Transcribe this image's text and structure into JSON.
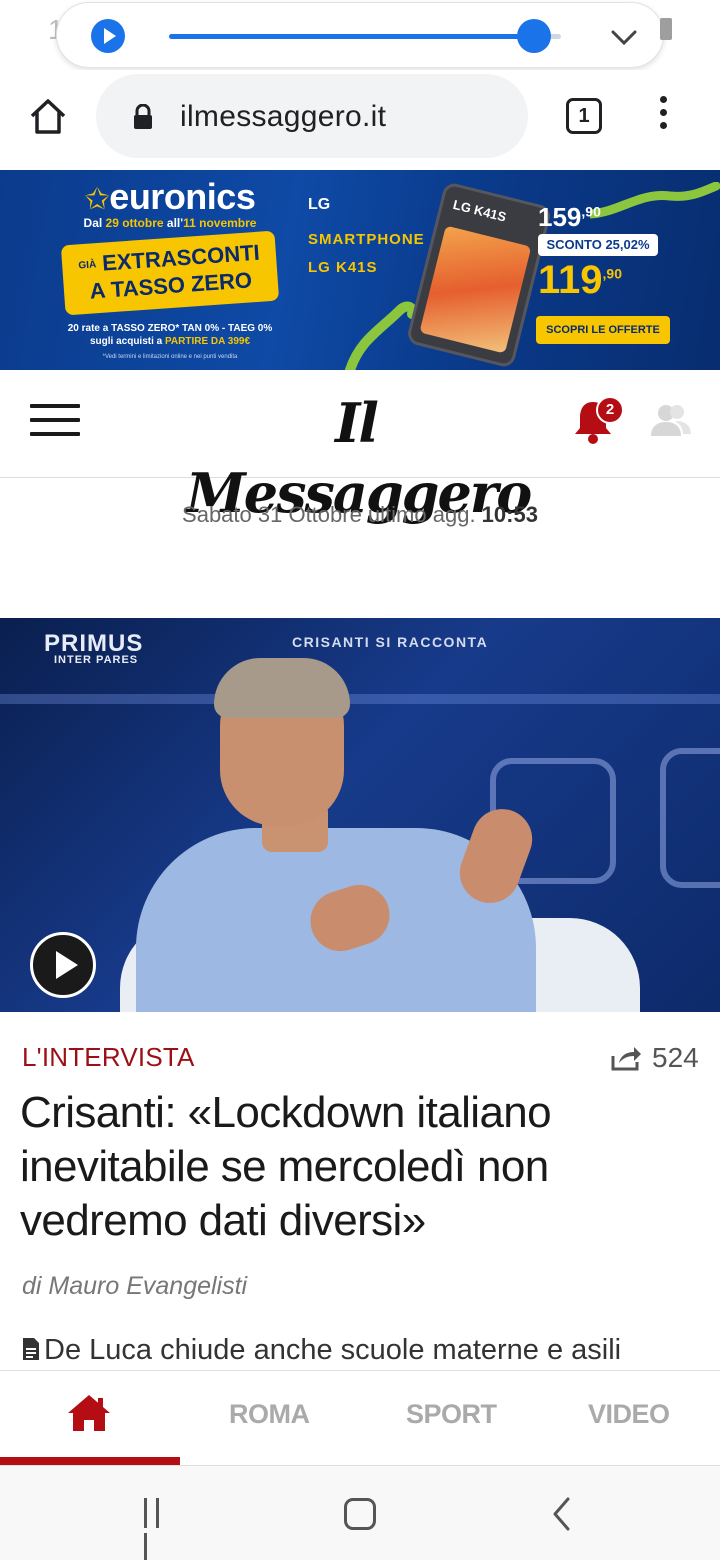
{
  "status": {
    "time": "10:5",
    "media_progress": 0.93
  },
  "browser": {
    "url": "ilmessaggero.it",
    "tab_count": "1",
    "icons": [
      "home-icon",
      "lock-icon",
      "tabs-icon",
      "more-vert-icon"
    ]
  },
  "ad": {
    "logo": "euronics",
    "dates_prefix": "Dal ",
    "date_from": "29 ottobre",
    "dates_mid": " all'",
    "date_to": "11 novembre",
    "promo_small": "GIÀ",
    "promo_line1": "EXTRASCONTI",
    "promo_line2": "A TASSO ZERO",
    "fine_line1": "20 rate a TASSO ZERO* TAN 0% - TAEG 0%",
    "fine_line2_prefix": "sugli acquisti a ",
    "fine_line2_highlight": "PARTIRE DA 399€",
    "fine_print": "*Vedi termini e limitazioni online e nei punti vendita",
    "brand": "LG",
    "model_line1": "SMARTPHONE",
    "model_line2": "LG K41S",
    "phone_label": "LG K41S",
    "old_price_int": "159",
    "old_price_dec": ",90",
    "discount_label": "SCONTO ",
    "discount_value": "25,02%",
    "new_price_int": "119",
    "new_price_dec": ",90",
    "cta": "SCOPRI LE OFFERTE",
    "accent": "#f7c600",
    "background": "#0e4aa6"
  },
  "header": {
    "logo": "Il Messaggero",
    "notification_count": "2",
    "accent": "#b40e14"
  },
  "date_line": {
    "text": "Sabato 31 Ottobre ultimo agg. ",
    "time": "10:53"
  },
  "hero": {
    "brand": "PRIMUS",
    "brand_sub": "INTER PARES",
    "caption": "CRISANTI SI RACCONTA"
  },
  "article": {
    "kicker": "L'INTERVISTA",
    "share_count": "524",
    "headline": "Crisanti: «Lockdown italiano inevitabile se mercoledì non vedremo dati diversi»",
    "byline": "di Mauro Evangelisti",
    "related": "De Luca chiude anche scuole materne e asili"
  },
  "bottom_nav": {
    "items": [
      "ROMA",
      "SPORT",
      "VIDEO"
    ],
    "active": "home"
  }
}
